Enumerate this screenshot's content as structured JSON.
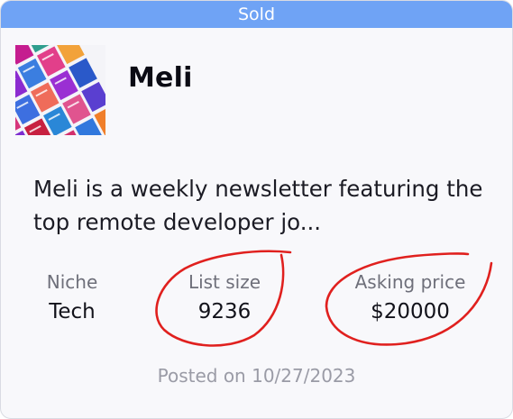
{
  "banner": {
    "label": "Sold",
    "color": "#6fa3f5"
  },
  "listing": {
    "title": "Meli",
    "thumbnail_icon": "newsletter-collage-thumbnail",
    "description": "Meli is a weekly newsletter featuring the top remote developer jo..."
  },
  "stats": {
    "niche": {
      "label": "Niche",
      "value": "Tech"
    },
    "list_size": {
      "label": "List size",
      "value": "9236"
    },
    "asking_price": {
      "label": "Asking price",
      "value": "$20000"
    }
  },
  "posted": {
    "prefix": "Posted on",
    "date": "10/27/2023"
  },
  "annotation_color": "#e0201e"
}
